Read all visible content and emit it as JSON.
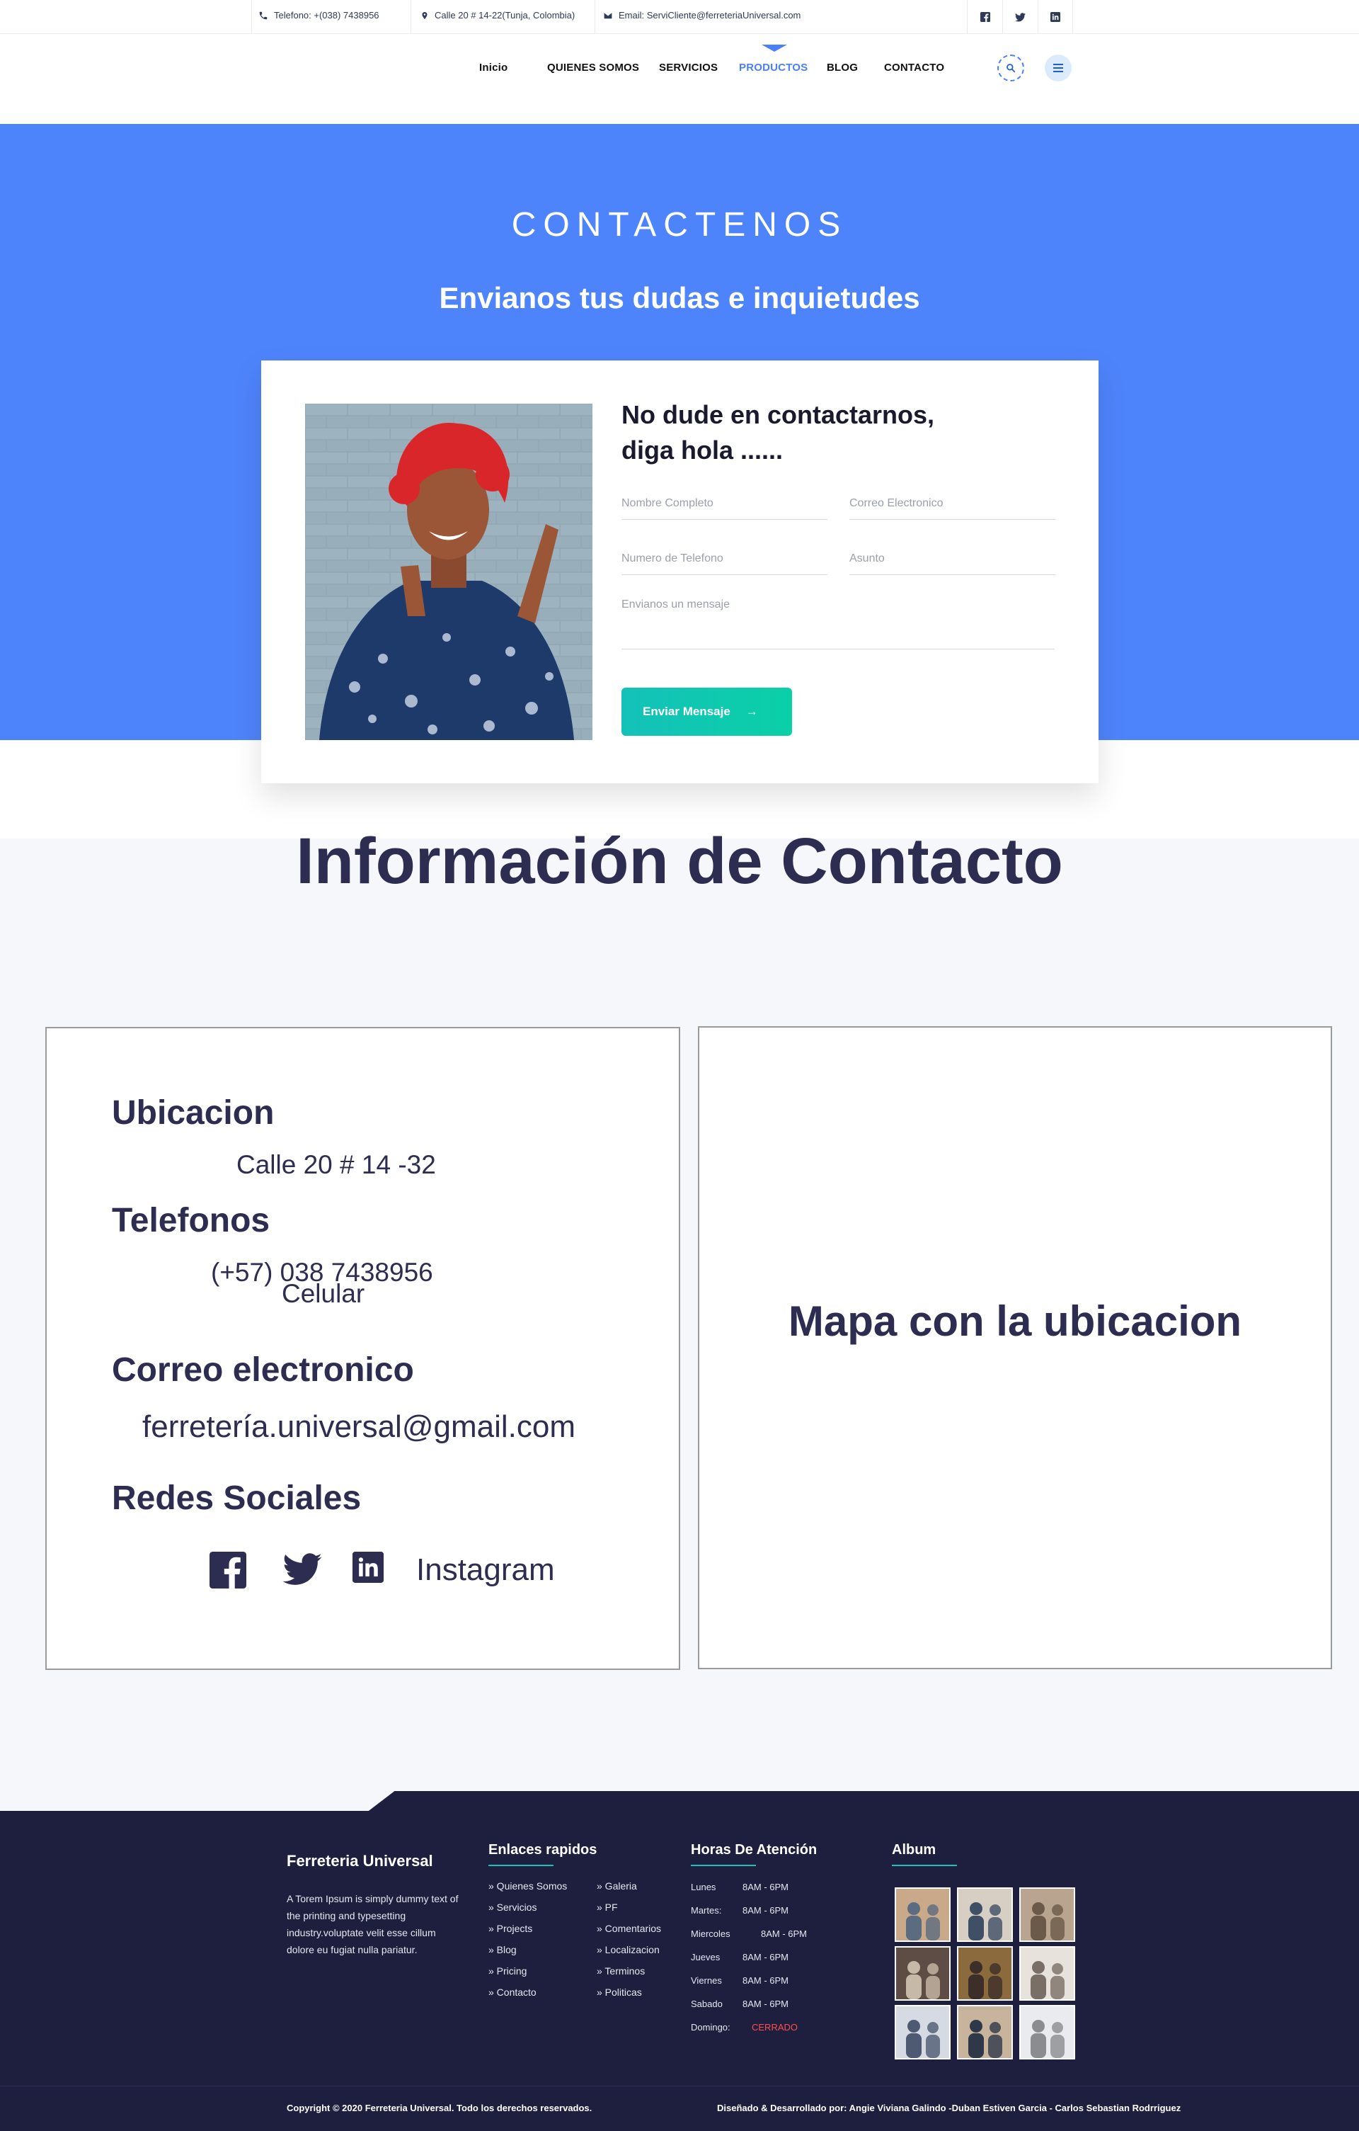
{
  "topbar": {
    "phone": "Telefono: +(038) 7438956",
    "address": "Calle 20 # 14-22(Tunja, Colombia)",
    "email": "Email: ServiCliente@ferreteriaUniversal.com",
    "social_icons": [
      "facebook-icon",
      "twitter-icon",
      "linkedin-icon"
    ]
  },
  "nav": {
    "items": [
      "Inicio",
      "QUIENES SOMOS",
      "SERVICIOS",
      "PRODUCTOS",
      "BLOG",
      "CONTACTO"
    ],
    "active": "PRODUCTOS",
    "accent": "#4a7ff5"
  },
  "hero": {
    "kicker": "CONTACTENOS",
    "title": "Envianos tus dudas e inquietudes",
    "background": "#4e84fb"
  },
  "form": {
    "title_line1": "No dude en contactarnos,",
    "title_line2": "diga hola ......",
    "name_placeholder": "Nombre Completo",
    "email_placeholder": "Correo Electronico",
    "phone_placeholder": "Numero de Telefono",
    "subject_placeholder": "Asunto",
    "message_placeholder": "Envianos un mensaje",
    "submit_label": "Enviar Mensaje",
    "submit_icon": "→"
  },
  "contact_info": {
    "title": "Información de Contacto",
    "location_heading": "Ubicacion",
    "location_value": "Calle 20 # 14 -32",
    "phones_heading": "Telefonos",
    "phone_value": "(+57) 038 7438956",
    "phone_type": "Celular",
    "email_heading": "Correo electronico",
    "email_value": "ferretería.universal@gmail.com",
    "social_heading": "Redes Sociales",
    "instagram_label": "Instagram",
    "map_placeholder": "Mapa con la ubicacion"
  },
  "footer": {
    "brand": "Ferreteria Universal",
    "about": "A Torem Ipsum is simply dummy text of the printing and typesetting industry.voluptate velit esse cillum dolore eu fugiat nulla pariatur.",
    "links_heading": "Enlaces rapidos",
    "links_col1": [
      "» Quienes Somos",
      "» Servicios",
      "» Projects",
      "» Blog",
      "» Pricing",
      "» Contacto"
    ],
    "links_col2": [
      "» Galeria",
      "» PF",
      "» Comentarios",
      "» Localizacion",
      "» Terminos",
      "» Politicas"
    ],
    "hours_heading": "Horas De Atención",
    "hours": [
      {
        "day": "Lunes",
        "time": "8AM - 6PM"
      },
      {
        "day": "Martes:",
        "time": "8AM - 6PM"
      },
      {
        "day": "Miercoles",
        "time": "8AM - 6PM"
      },
      {
        "day": "Jueves",
        "time": "8AM - 6PM"
      },
      {
        "day": "Viernes",
        "time": "8AM - 6PM"
      },
      {
        "day": "Sabado",
        "time": "8AM - 6PM"
      },
      {
        "day": "Domingo:",
        "time": "CERRADO"
      }
    ],
    "closed_color": "#ff4d4d",
    "album_heading": "Album",
    "copyright": "Copyright © 2020 Ferreteria Universal. Todo los derechos reservados.",
    "credits": "Diseñado & Desarrollado por: Angie Viviana Galindo -Duban Estiven Garcia - Carlos Sebastian Rodrriguez"
  }
}
